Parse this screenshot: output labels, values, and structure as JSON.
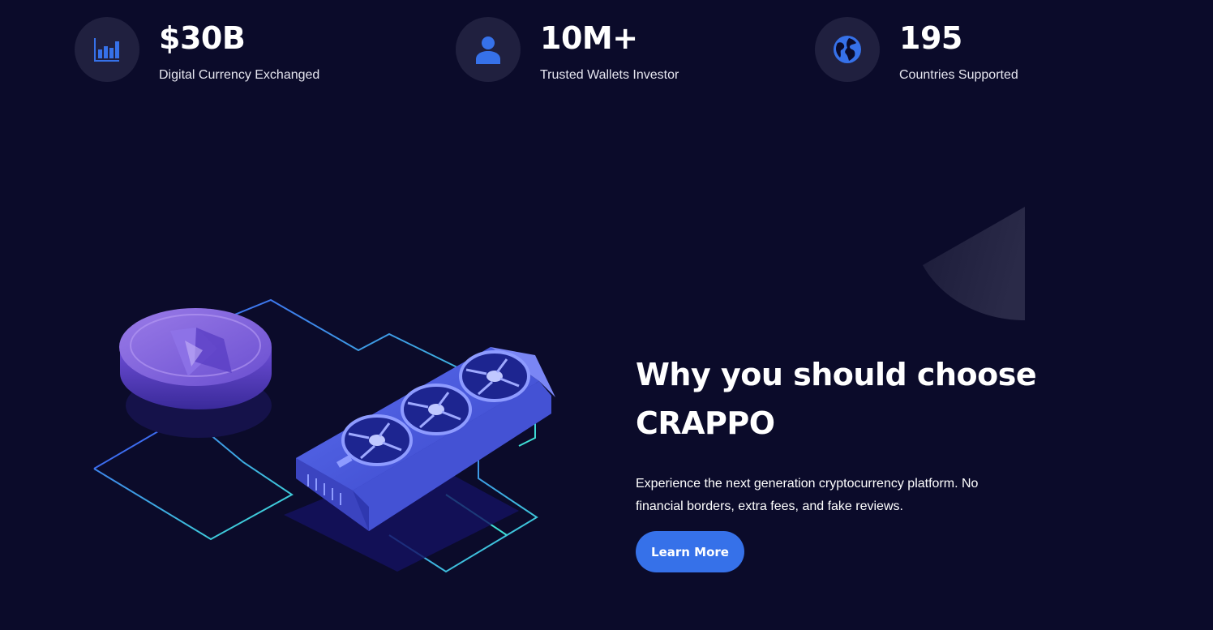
{
  "stats": [
    {
      "value": "$30B",
      "label": "Digital Currency Exchanged",
      "icon": "bar-chart-icon"
    },
    {
      "value": "10M+",
      "label": "Trusted Wallets Investor",
      "icon": "user-icon"
    },
    {
      "value": "195",
      "label": "Countries Supported",
      "icon": "globe-icon"
    }
  ],
  "why": {
    "heading": "Why you should choose CRAPPO",
    "description": "Experience the next generation cryptocurrency platform. No financial borders, extra fees, and fake reviews.",
    "button_label": "Learn More"
  },
  "colors": {
    "background": "#0b0b2a",
    "icon_circle": "#20203f",
    "accent_blue": "#3671e9",
    "text": "#ffffff"
  }
}
